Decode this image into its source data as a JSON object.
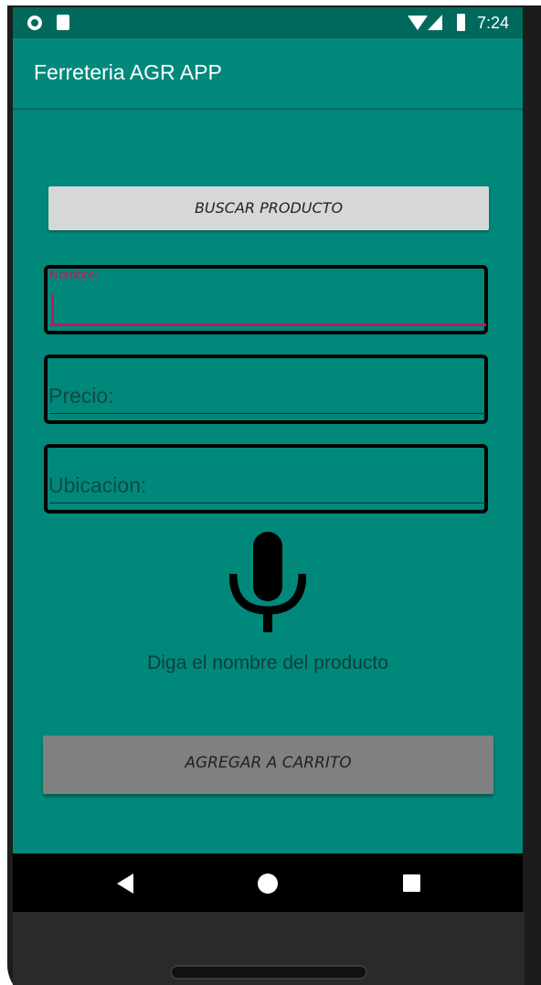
{
  "status_bar": {
    "time": "7:24",
    "icons": [
      "notification-circle-icon",
      "sd-card-icon",
      "wifi-icon",
      "cell-signal-icon",
      "battery-icon"
    ]
  },
  "app_bar": {
    "title": "Ferreteria AGR APP"
  },
  "form": {
    "search_button_label": "BUSCAR PRODUCTO",
    "nombre": {
      "label": "Nombre:",
      "value": "",
      "focused": true
    },
    "precio": {
      "placeholder": "Precio:",
      "value": ""
    },
    "ubicacion": {
      "placeholder": "Ubicacion:",
      "value": ""
    },
    "mic_icon": "microphone-icon",
    "voice_prompt": "Diga el nombre del producto",
    "add_to_cart_label": "AGREGAR A CARRITO"
  },
  "navigation": {
    "icons": [
      "back-icon",
      "home-icon",
      "recents-icon"
    ]
  },
  "colors": {
    "primary": "#00897b",
    "primary_dark": "#00695c",
    "accent": "#c2185b",
    "search_button": "#d6d7d7",
    "cart_button": "#808080"
  }
}
